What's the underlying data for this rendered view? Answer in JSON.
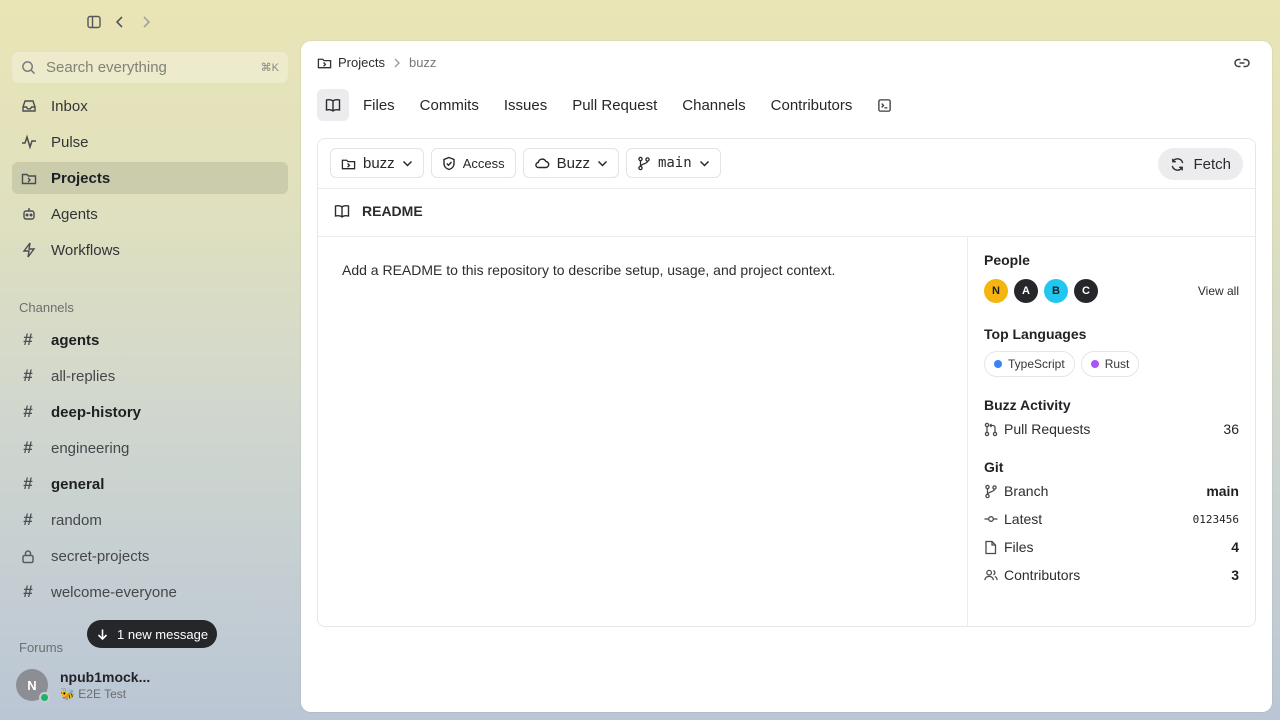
{
  "sidebar": {
    "search": {
      "placeholder": "Search everything",
      "shortcut": "⌘K"
    },
    "nav": [
      {
        "label": "Inbox",
        "icon": "inbox-icon"
      },
      {
        "label": "Pulse",
        "icon": "pulse-icon"
      },
      {
        "label": "Projects",
        "icon": "projects-icon",
        "active": true
      },
      {
        "label": "Agents",
        "icon": "agents-icon"
      },
      {
        "label": "Workflows",
        "icon": "workflows-icon"
      }
    ],
    "channels_label": "Channels",
    "channels": [
      {
        "name": "agents",
        "unread": true
      },
      {
        "name": "all-replies",
        "unread": false
      },
      {
        "name": "deep-history",
        "unread": true
      },
      {
        "name": "engineering",
        "unread": false
      },
      {
        "name": "general",
        "unread": true
      },
      {
        "name": "random",
        "unread": false
      },
      {
        "name": "secret-projects",
        "unread": false,
        "private": true
      },
      {
        "name": "welcome-everyone",
        "unread": false
      }
    ],
    "forums_label": "Forums",
    "new_message_toast": "1 new message",
    "user": {
      "initial": "N",
      "name": "npub1mock...",
      "status": "🐝 E2E Test",
      "online_color": "#1fb36a"
    }
  },
  "main": {
    "breadcrumb": {
      "root": "Projects",
      "current": "buzz"
    },
    "tabs": [
      "Files",
      "Commits",
      "Issues",
      "Pull Request",
      "Channels",
      "Contributors"
    ],
    "toolbar": {
      "repo": "buzz",
      "access": "Access",
      "remote": "Buzz",
      "branch": "main",
      "fetch": "Fetch"
    },
    "readme": {
      "title": "README",
      "body": "Add a README to this repository to describe setup, usage, and project context."
    },
    "side": {
      "people_title": "People",
      "people": [
        {
          "initial": "N",
          "bg": "#f5b50e",
          "fg": "#1f2023"
        },
        {
          "initial": "A",
          "bg": "#25272a",
          "fg": "#ffffff"
        },
        {
          "initial": "B",
          "bg": "#22c7ef",
          "fg": "#1f2023"
        },
        {
          "initial": "C",
          "bg": "#25272a",
          "fg": "#ffffff"
        }
      ],
      "view_all": "View all",
      "languages_title": "Top Languages",
      "languages": [
        {
          "name": "TypeScript",
          "color": "#3b82f6"
        },
        {
          "name": "Rust",
          "color": "#a855f7"
        }
      ],
      "activity_title": "Buzz Activity",
      "pull_requests_label": "Pull Requests",
      "pull_requests_value": "36",
      "git_title": "Git",
      "branch_label": "Branch",
      "branch_value": "main",
      "latest_label": "Latest",
      "latest_value": "0123456",
      "files_label": "Files",
      "files_value": "4",
      "contributors_label": "Contributors",
      "contributors_value": "3"
    }
  }
}
